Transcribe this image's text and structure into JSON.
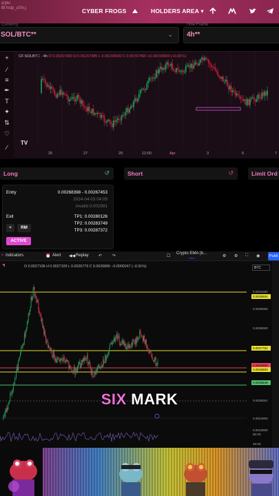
{
  "topbar": {
    "ghost_lines": [
      "a'pto",
      "Bi hctp_a'0n.j"
    ],
    "nav_cyber": "CYBER FROGS",
    "nav_holders": "HOLDERS AREA ▾",
    "icons": [
      "frog-icon",
      "arrow-up-icon",
      "mexc-icon",
      "twitter-icon",
      "telegram-icon"
    ]
  },
  "selectors": {
    "currency_label": "Currency",
    "currency_value": "SOL/BTC**",
    "timeframe_label": "Time Frame",
    "timeframe_value": "4h**"
  },
  "chart1": {
    "legend_symbol": "CF:SOLBTC · 4h",
    "legend_values": "O 0.00267683  H 0.00267485  L 0.00266590  C 0.00267465  +0.00000004 (+0.00%)",
    "x_labels": [
      "25",
      "27",
      "29",
      "12:00",
      "Apr",
      "3",
      "5",
      "7"
    ],
    "tv_logo": "TV"
  },
  "trade_buttons": {
    "long": "Long",
    "short": "Short",
    "limit": "Limit Ord"
  },
  "signal": {
    "entry_label": "Entry",
    "entry_range": "0.00268398 - 0.00267453",
    "entry_time": "2024-04-03 04:09",
    "invalid": "Invalid 0.002991",
    "exit_label": "Exit",
    "tp1": "TP1: 0.00280126",
    "tp2": "TP2: 0.00283749",
    "tp3": "TP3: 0.00287372",
    "plus_label": "+",
    "rm_label": "RM",
    "active_label": "ACTIVE"
  },
  "tv": {
    "toolbar_indicators": "Indicators",
    "toolbar_alert": "Alert",
    "toolbar_replay": "Replay",
    "toolbar_title": "Crypto EMA (b...",
    "toolbar_save": "Save",
    "toolbar_publish": "Publi",
    "legend": "O 0.0027106  H 0.0027109  L 0.0026779  C 0.0026890  −0.0000247 (−0.91%)",
    "currency": "BTC",
    "y_labels": [
      "0.0031000",
      "0.0030000",
      "0.0029000",
      "0.0028000",
      "0.0027000",
      "0.0026000",
      "0.0025001",
      "0.0024000",
      "0.0023000",
      "60.00",
      "40.00"
    ],
    "price_tags": [
      {
        "text": "0.0030604",
        "color": "#e8e030"
      },
      {
        "text": "0.0027752",
        "color": "#e8e030"
      },
      {
        "text": "0.0026890",
        "color": "#f04060"
      },
      {
        "text": "0.0026800",
        "color": "#e8e030"
      },
      {
        "text": "0.0025848",
        "color": "#50c070"
      }
    ],
    "caption_pink": "SIX",
    "caption_white": " MARK"
  }
}
